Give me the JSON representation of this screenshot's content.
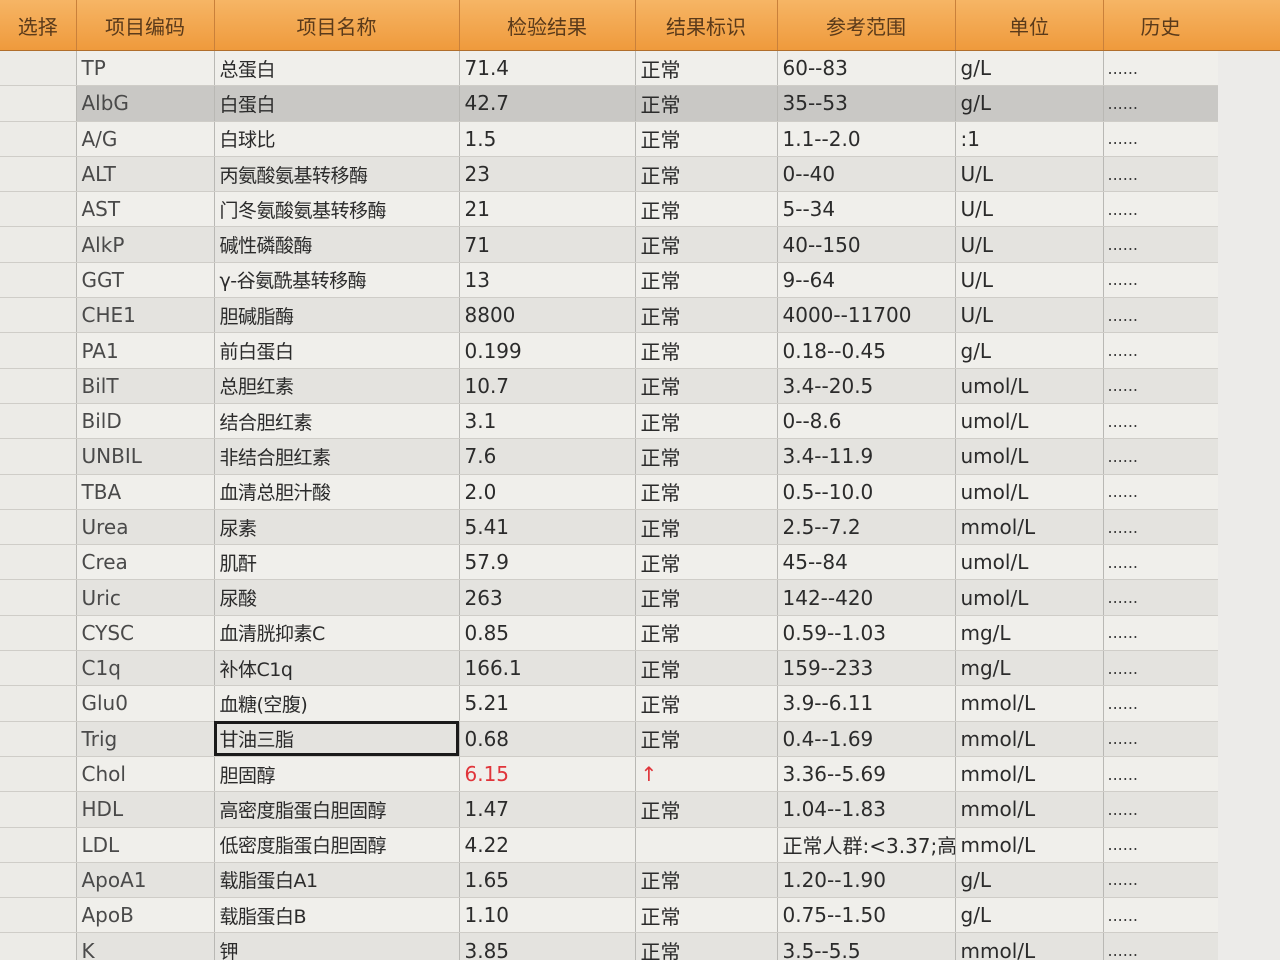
{
  "headers": {
    "select": "选择",
    "code": "项目编码",
    "name": "项目名称",
    "result": "检验结果",
    "flag": "结果标识",
    "range": "参考范围",
    "unit": "单位",
    "history": "历史"
  },
  "rows": [
    {
      "code": "TP",
      "name": "总蛋白",
      "result": "71.4",
      "flag": "正常",
      "range": "60--83",
      "unit": "g/L",
      "history": "......"
    },
    {
      "code": "AlbG",
      "name": "白蛋白",
      "result": "42.7",
      "flag": "正常",
      "range": "35--53",
      "unit": "g/L",
      "history": "......"
    },
    {
      "code": "A/G",
      "name": "白球比",
      "result": "1.5",
      "flag": "正常",
      "range": "1.1--2.0",
      "unit": ":1",
      "history": "......"
    },
    {
      "code": "ALT",
      "name": "丙氨酸氨基转移酶",
      "result": "23",
      "flag": "正常",
      "range": "0--40",
      "unit": "U/L",
      "history": "......"
    },
    {
      "code": "AST",
      "name": "门冬氨酸氨基转移酶",
      "result": "21",
      "flag": "正常",
      "range": "5--34",
      "unit": "U/L",
      "history": "......"
    },
    {
      "code": "AlkP",
      "name": "碱性磷酸酶",
      "result": "71",
      "flag": "正常",
      "range": "40--150",
      "unit": "U/L",
      "history": "......"
    },
    {
      "code": "GGT",
      "name": "γ-谷氨酰基转移酶",
      "result": "13",
      "flag": "正常",
      "range": "9--64",
      "unit": "U/L",
      "history": "......"
    },
    {
      "code": "CHE1",
      "name": "胆碱脂酶",
      "result": "8800",
      "flag": "正常",
      "range": "4000--11700",
      "unit": "U/L",
      "history": "......"
    },
    {
      "code": "PA1",
      "name": "前白蛋白",
      "result": "0.199",
      "flag": "正常",
      "range": "0.18--0.45",
      "unit": "g/L",
      "history": "......"
    },
    {
      "code": "BilT",
      "name": "总胆红素",
      "result": "10.7",
      "flag": "正常",
      "range": "3.4--20.5",
      "unit": "umol/L",
      "history": "......"
    },
    {
      "code": "BilD",
      "name": "结合胆红素",
      "result": "3.1",
      "flag": "正常",
      "range": "0--8.6",
      "unit": "umol/L",
      "history": "......"
    },
    {
      "code": "UNBIL",
      "name": "非结合胆红素",
      "result": "7.6",
      "flag": "正常",
      "range": "3.4--11.9",
      "unit": "umol/L",
      "history": "......"
    },
    {
      "code": "TBA",
      "name": "血清总胆汁酸",
      "result": "2.0",
      "flag": "正常",
      "range": "0.5--10.0",
      "unit": "umol/L",
      "history": "......"
    },
    {
      "code": "Urea",
      "name": "尿素",
      "result": "5.41",
      "flag": "正常",
      "range": "2.5--7.2",
      "unit": "mmol/L",
      "history": "......"
    },
    {
      "code": "Crea",
      "name": "肌酐",
      "result": "57.9",
      "flag": "正常",
      "range": "45--84",
      "unit": "umol/L",
      "history": "......"
    },
    {
      "code": "Uric",
      "name": "尿酸",
      "result": "263",
      "flag": "正常",
      "range": "142--420",
      "unit": "umol/L",
      "history": "......"
    },
    {
      "code": "CYSC",
      "name": "血清胱抑素C",
      "result": "0.85",
      "flag": "正常",
      "range": "0.59--1.03",
      "unit": "mg/L",
      "history": "......"
    },
    {
      "code": "C1q",
      "name": "补体C1q",
      "result": "166.1",
      "flag": "正常",
      "range": "159--233",
      "unit": "mg/L",
      "history": "......"
    },
    {
      "code": "Glu0",
      "name": "血糖(空腹)",
      "result": "5.21",
      "flag": "正常",
      "range": "3.9--6.11",
      "unit": "mmol/L",
      "history": "......"
    },
    {
      "code": "Trig",
      "name": "甘油三脂",
      "result": "0.68",
      "flag": "正常",
      "range": "0.4--1.69",
      "unit": "mmol/L",
      "history": "......"
    },
    {
      "code": "Chol",
      "name": "胆固醇",
      "result": "6.15",
      "flag": "↑",
      "range": "3.36--5.69",
      "unit": "mmol/L",
      "history": "......"
    },
    {
      "code": "HDL",
      "name": "高密度脂蛋白胆固醇",
      "result": "1.47",
      "flag": "正常",
      "range": "1.04--1.83",
      "unit": "mmol/L",
      "history": "......"
    },
    {
      "code": "LDL",
      "name": "低密度脂蛋白胆固醇",
      "result": "4.22",
      "flag": "",
      "range": "正常人群:<3.37;高",
      "unit": "mmol/L",
      "history": "......"
    },
    {
      "code": "ApoA1",
      "name": "载脂蛋白A1",
      "result": "1.65",
      "flag": "正常",
      "range": "1.20--1.90",
      "unit": "g/L",
      "history": "......"
    },
    {
      "code": "ApoB",
      "name": "载脂蛋白B",
      "result": "1.10",
      "flag": "正常",
      "range": "0.75--1.50",
      "unit": "g/L",
      "history": "......"
    },
    {
      "code": "K",
      "name": "钾",
      "result": "3.85",
      "flag": "正常",
      "range": "3.5--5.5",
      "unit": "mmol/L",
      "history": "......"
    }
  ],
  "colors": {
    "header": "#ef9a3c",
    "high": "#e0343a"
  }
}
